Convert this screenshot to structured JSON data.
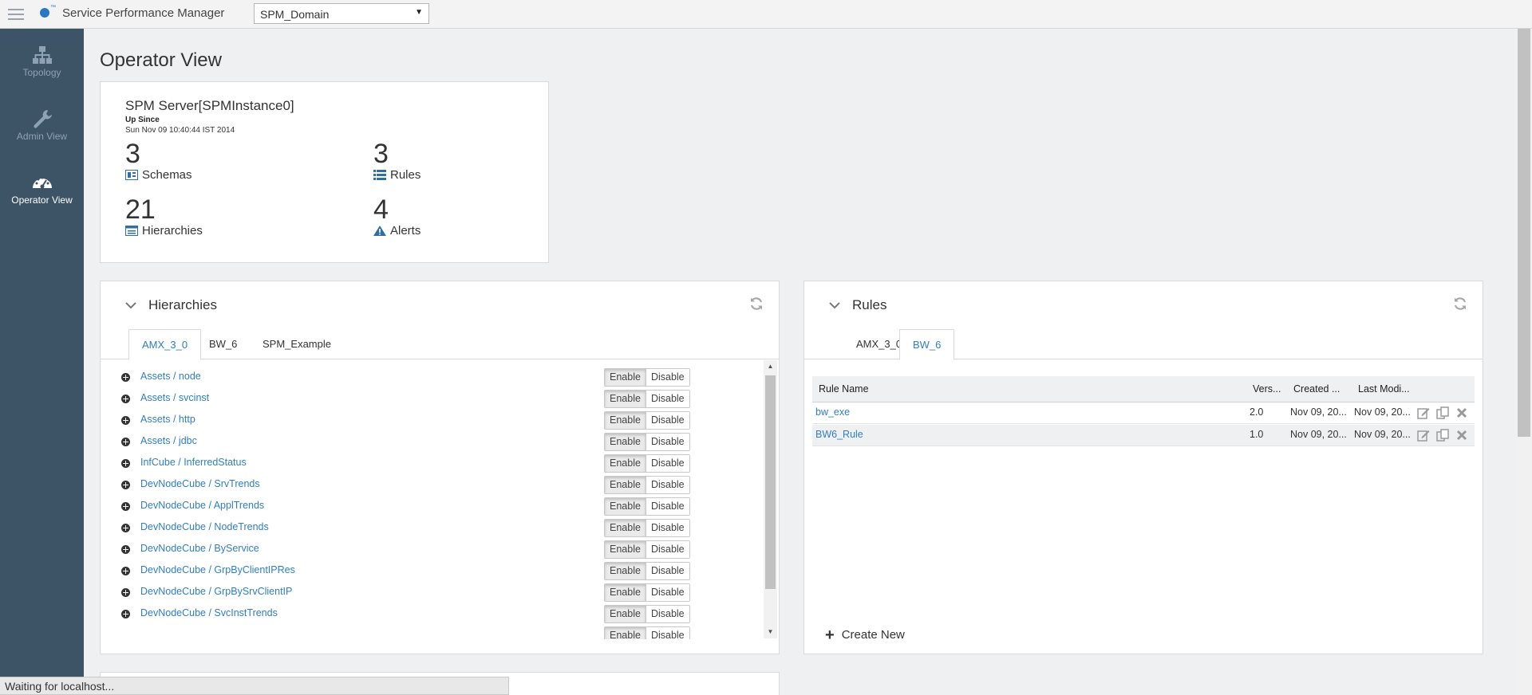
{
  "app": {
    "title": "Service Performance Manager",
    "domain": "SPM_Domain"
  },
  "sidebar": {
    "items": [
      {
        "label": "Topology",
        "icon": "topology-icon"
      },
      {
        "label": "Admin View",
        "icon": "wrench-icon"
      },
      {
        "label": "Operator View",
        "icon": "dashboard-icon"
      }
    ]
  },
  "page": {
    "title": "Operator View"
  },
  "summary": {
    "server": "SPM Server[SPMInstance0]",
    "up_since_label": "Up Since",
    "up_since_value": "Sun Nov 09 10:40:44 IST 2014",
    "stats": [
      {
        "value": "3",
        "label": "Schemas",
        "icon": "schema-icon"
      },
      {
        "value": "3",
        "label": "Rules",
        "icon": "list-icon"
      },
      {
        "value": "21",
        "label": "Hierarchies",
        "icon": "hierarchy-icon"
      },
      {
        "value": "4",
        "label": "Alerts",
        "icon": "warning-icon"
      }
    ]
  },
  "hierarchies": {
    "title": "Hierarchies",
    "tabs": [
      "AMX_3_0",
      "BW_6",
      "SPM_Example"
    ],
    "active_tab": "AMX_3_0",
    "enable_label": "Enable",
    "disable_label": "Disable",
    "items": [
      "Assets / node",
      "Assets / svcinst",
      "Assets / http",
      "Assets / jdbc",
      "InfCube / InferredStatus",
      "DevNodeCube / SrvTrends",
      "DevNodeCube / ApplTrends",
      "DevNodeCube / NodeTrends",
      "DevNodeCube / ByService",
      "DevNodeCube / GrpByClientIPRes",
      "DevNodeCube / GrpBySrvClientIP",
      "DevNodeCube / SvcInstTrends"
    ]
  },
  "rules": {
    "title": "Rules",
    "tabs": [
      "AMX_3_0",
      "BW_6"
    ],
    "active_tab": "BW_6",
    "columns": [
      "Rule Name",
      "Vers...",
      "Created ...",
      "Last Modi..."
    ],
    "rows": [
      {
        "name": "bw_exe",
        "version": "2.0",
        "created": "Nov 09, 20...",
        "modified": "Nov 09, 20..."
      },
      {
        "name": "BW6_Rule",
        "version": "1.0",
        "created": "Nov 09, 20...",
        "modified": "Nov 09, 20..."
      }
    ],
    "create_label": "Create New"
  },
  "status_bar": {
    "text": "Waiting for localhost..."
  },
  "colors": {
    "sidebar": "#3d5366",
    "link": "#2f7ec4",
    "background": "#eef0f2"
  }
}
